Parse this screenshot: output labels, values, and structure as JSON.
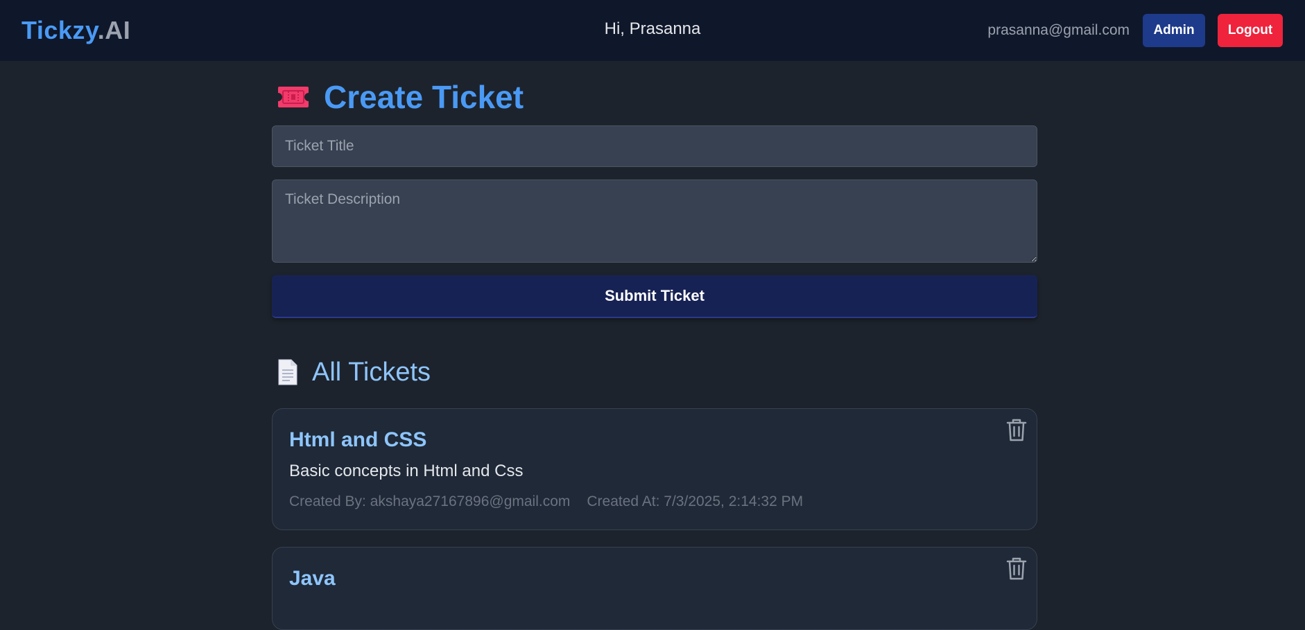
{
  "brand": {
    "part1": "Tickzy",
    "part2": ".AI"
  },
  "header": {
    "greeting": "Hi, Prasanna",
    "email": "prasanna@gmail.com",
    "admin_label": "Admin",
    "logout_label": "Logout"
  },
  "create": {
    "icon": "ticket-icon",
    "heading": "Create Ticket",
    "title_placeholder": "Ticket Title",
    "title_value": "",
    "description_placeholder": "Ticket Description",
    "description_value": "",
    "submit_label": "Submit Ticket"
  },
  "tickets_section": {
    "icon": "document-icon",
    "heading": "All Tickets"
  },
  "tickets": [
    {
      "title": "Html and CSS",
      "description": "Basic concepts in Html and Css",
      "created_by": "Created By: akshaya27167896@gmail.com",
      "created_at": "Created At: 7/3/2025, 2:14:32 PM",
      "action_icon": "trash-icon"
    },
    {
      "title": "Java",
      "action_icon": "trash-icon"
    }
  ],
  "colors": {
    "background": "#1d232c",
    "navbar": "#0f172a",
    "brand_blue": "#4a9af5",
    "admin_button": "#1e3a8a",
    "logout_button": "#ef233c",
    "submit_button": "#172254",
    "ticket_title": "#8ec5fc",
    "ticket_icon": "#f23b6b"
  }
}
